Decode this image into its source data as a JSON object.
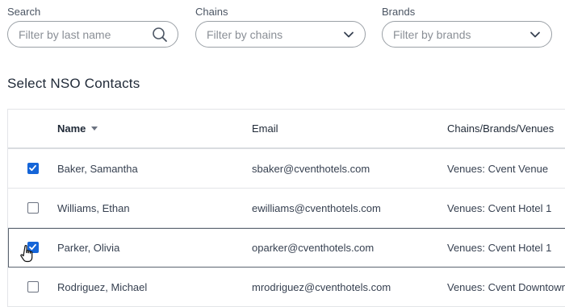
{
  "filters": {
    "search": {
      "label": "Search",
      "placeholder": "Filter by last name",
      "icon": "search-icon"
    },
    "chains": {
      "label": "Chains",
      "placeholder": "Filter by chains",
      "icon": "chevron-down-icon"
    },
    "brands": {
      "label": "Brands",
      "placeholder": "Filter by brands",
      "icon": "chevron-down-icon"
    }
  },
  "section_title": "Select NSO Contacts",
  "table": {
    "columns": {
      "name": "Name",
      "email": "Email",
      "chains": "Chains/Brands/Venues"
    },
    "sort": {
      "column": "name",
      "direction": "descending"
    },
    "rows": [
      {
        "name": "Baker, Samantha",
        "email": "sbaker@cventhotels.com",
        "chains": "Venues: Cvent Venue",
        "checked": true
      },
      {
        "name": "Williams, Ethan",
        "email": "ewilliams@cventhotels.com",
        "chains": "Venues: Cvent Hotel 1",
        "checked": false
      },
      {
        "name": "Parker, Olivia",
        "email": "oparker@cventhotels.com",
        "chains": "Venues: Cvent Hotel 1",
        "checked": true
      },
      {
        "name": "Rodriguez, Michael",
        "email": "mrodriguez@cventhotels.com",
        "chains": "Venues: Cvent Downtown",
        "checked": false
      }
    ]
  },
  "colors": {
    "accent": "#1565d8",
    "border": "#9aa0a6",
    "row_divider": "#e3e5e8"
  }
}
